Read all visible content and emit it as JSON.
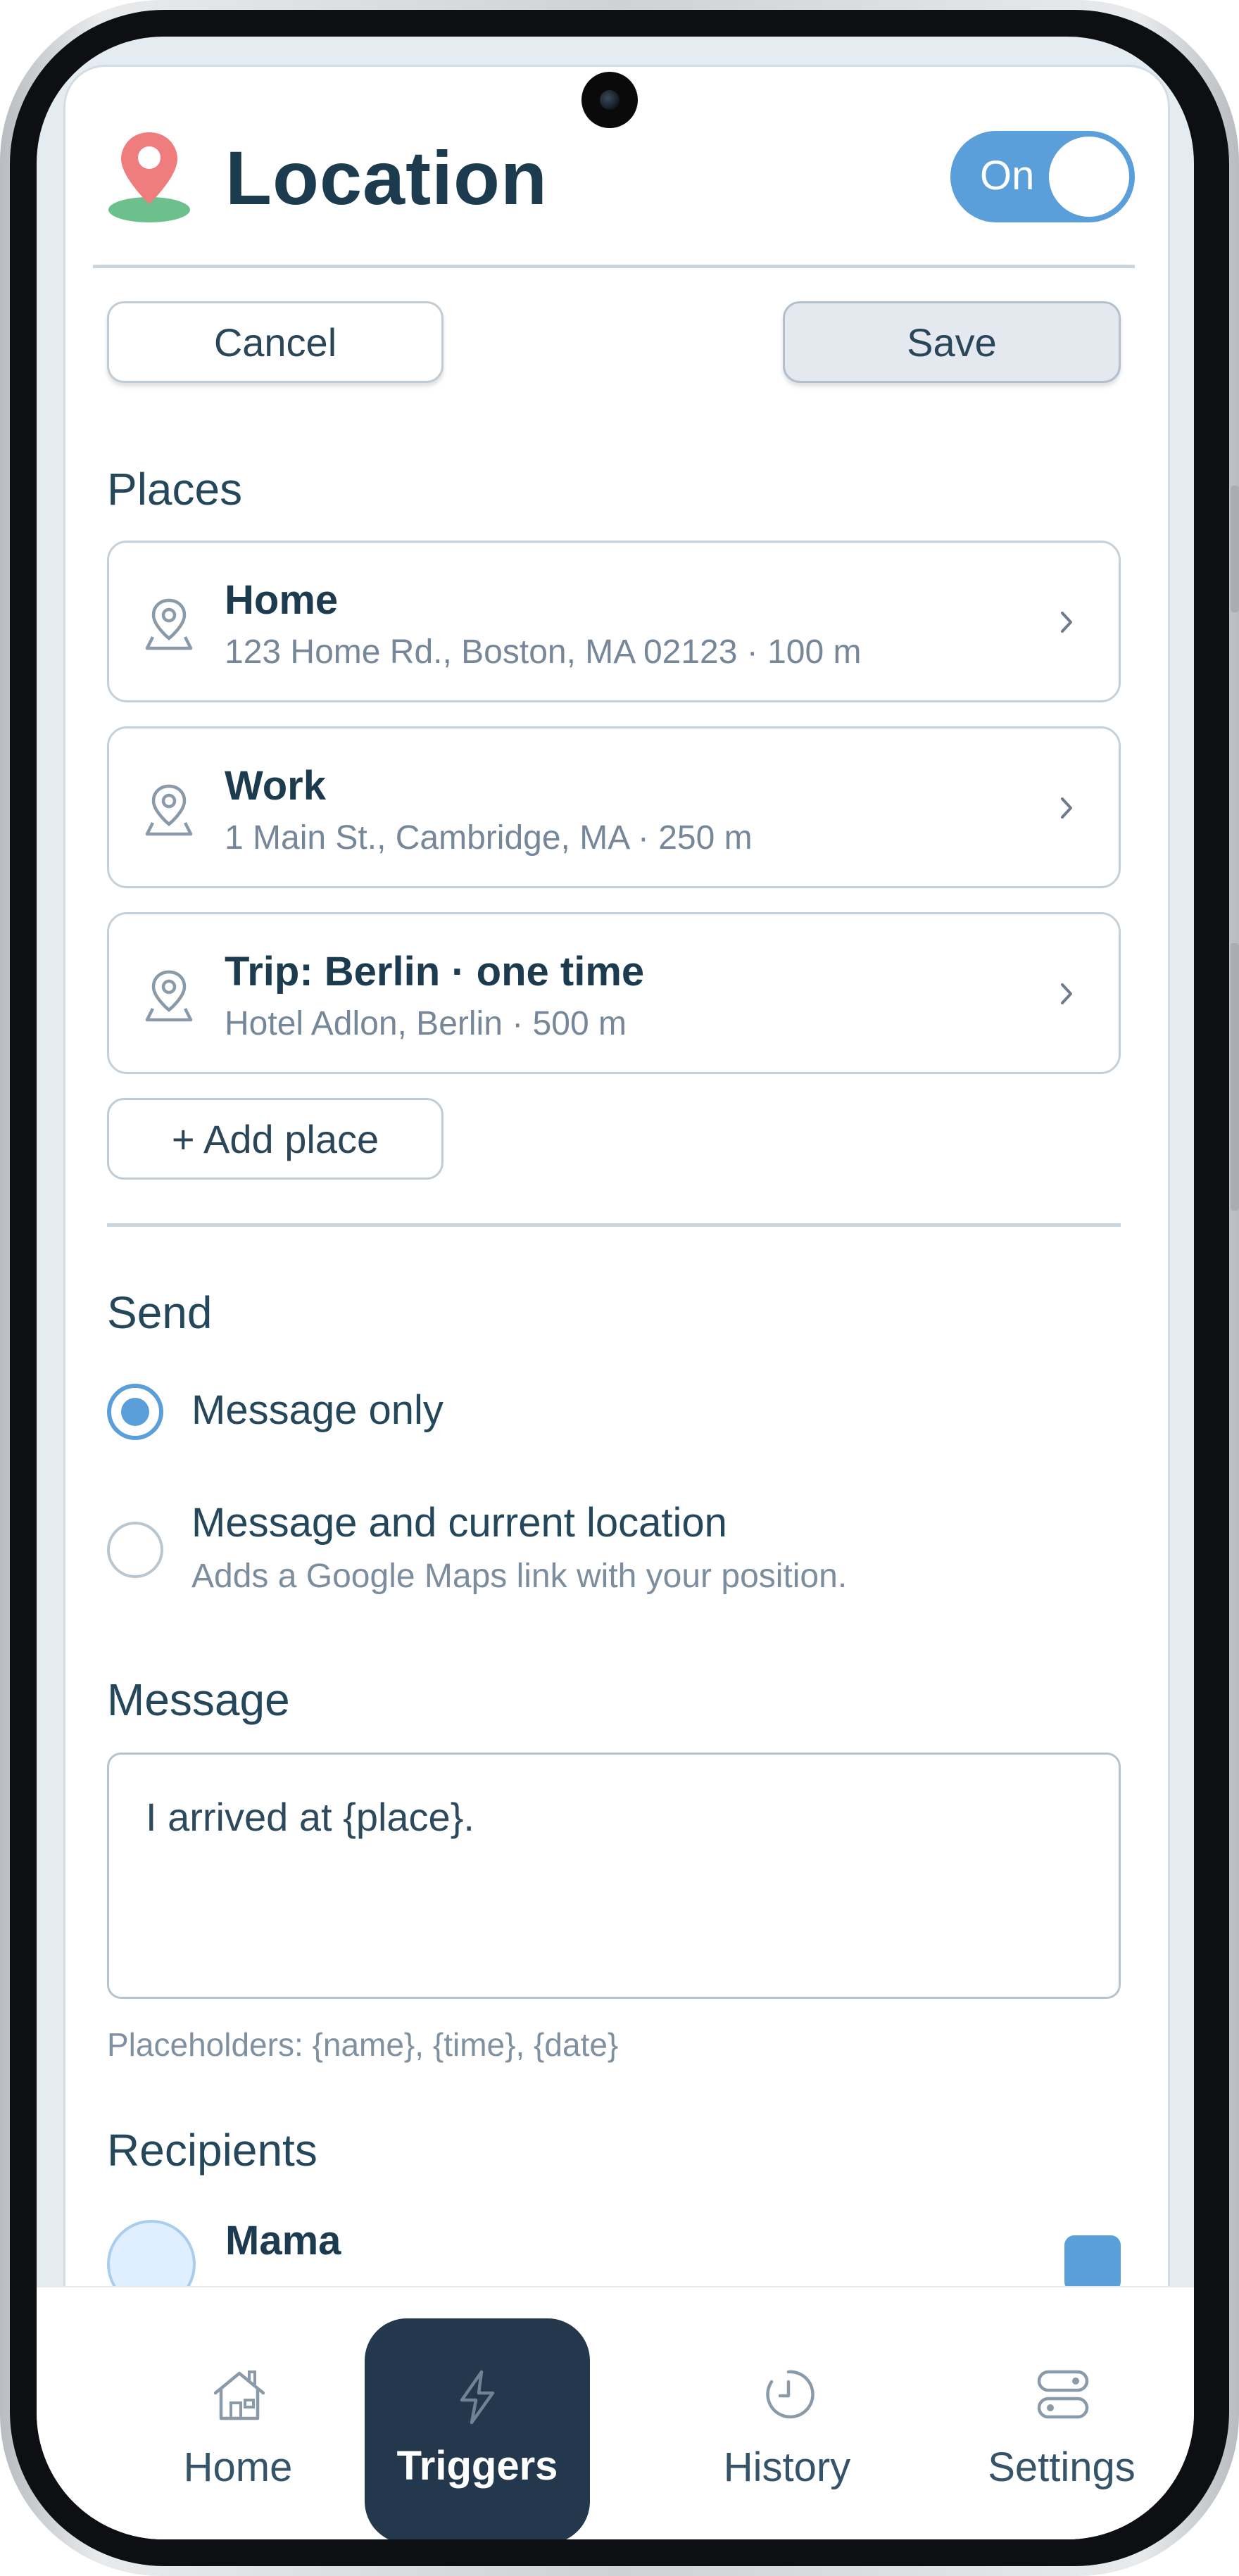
{
  "header": {
    "title": "Location",
    "toggle_label": "On"
  },
  "actions": {
    "cancel_label": "Cancel",
    "save_label": "Save"
  },
  "places": {
    "heading": "Places",
    "items": [
      {
        "name": "Home",
        "detail": "123 Home Rd., Boston, MA 02123 · 100 m"
      },
      {
        "name": "Work",
        "detail": "1 Main St., Cambridge, MA · 250 m"
      },
      {
        "name": "Trip: Berlin · one time",
        "detail": "Hotel Adlon, Berlin · 500 m"
      }
    ],
    "add_label": "+ Add place"
  },
  "send": {
    "heading": "Send",
    "options": [
      {
        "label": "Message only",
        "selected": true
      },
      {
        "label": "Message and current location",
        "sub": "Adds a Google Maps link with your position.",
        "selected": false
      }
    ]
  },
  "message": {
    "heading": "Message",
    "value": "I arrived at {place}.",
    "hint": "Placeholders: {name}, {time}, {date}"
  },
  "recipients": {
    "heading": "Recipients",
    "items": [
      {
        "name": "Mama"
      }
    ]
  },
  "nav": {
    "items": [
      {
        "label": "Home",
        "icon": "home-icon"
      },
      {
        "label": "Triggers",
        "icon": "lightning-icon",
        "active": true
      },
      {
        "label": "History",
        "icon": "clock-icon"
      },
      {
        "label": "Settings",
        "icon": "toggles-icon"
      }
    ]
  },
  "colors": {
    "accent": "#5b9fda",
    "title": "#1c3b4f",
    "nav_active": "#23384c"
  }
}
